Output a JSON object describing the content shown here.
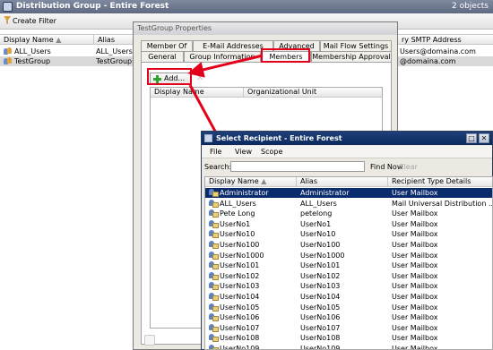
{
  "main": {
    "title": "Distribution Group - Entire Forest",
    "object_count": "2 objects",
    "toolbar": {
      "create_filter": "Create Filter"
    },
    "columns": [
      "Display Name",
      "Alias",
      "ry SMTP Address"
    ],
    "rows": [
      {
        "name": "ALL_Users",
        "alias": "ALL_Users",
        "smtp": "Users@domaina.com"
      },
      {
        "name": "TestGroup",
        "alias": "TestGroup",
        "smtp": "@domaina.com"
      }
    ]
  },
  "props": {
    "title": "TestGroup Properties",
    "tabs_back": [
      "Member Of",
      "E-Mail Addresses",
      "Advanced",
      "Mail Flow Settings"
    ],
    "tabs_front": [
      "General",
      "Group Information",
      "Members",
      "Membership Approval"
    ],
    "add_button": "Add...",
    "columns": [
      "Display Name",
      "Organizational Unit"
    ]
  },
  "select": {
    "title": "Select Recipient - Entire Forest",
    "menu": [
      "File",
      "View",
      "Scope"
    ],
    "search_label": "Search:",
    "search_value": "",
    "find_now": "Find Now",
    "clear": "Clear",
    "columns": [
      "Display Name",
      "Alias",
      "Recipient Type Details"
    ],
    "rows": [
      {
        "name": "Administrator",
        "alias": "Administrator",
        "type": "User Mailbox"
      },
      {
        "name": "ALL_Users",
        "alias": "ALL_Users",
        "type": "Mail Universal Distribution ..."
      },
      {
        "name": "Pete Long",
        "alias": "petelong",
        "type": "User Mailbox"
      },
      {
        "name": "UserNo1",
        "alias": "UserNo1",
        "type": "User Mailbox"
      },
      {
        "name": "UserNo10",
        "alias": "UserNo10",
        "type": "User Mailbox"
      },
      {
        "name": "UserNo100",
        "alias": "UserNo100",
        "type": "User Mailbox"
      },
      {
        "name": "UserNo1000",
        "alias": "UserNo1000",
        "type": "User Mailbox"
      },
      {
        "name": "UserNo101",
        "alias": "UserNo101",
        "type": "User Mailbox"
      },
      {
        "name": "UserNo102",
        "alias": "UserNo102",
        "type": "User Mailbox"
      },
      {
        "name": "UserNo103",
        "alias": "UserNo103",
        "type": "User Mailbox"
      },
      {
        "name": "UserNo104",
        "alias": "UserNo104",
        "type": "User Mailbox"
      },
      {
        "name": "UserNo105",
        "alias": "UserNo105",
        "type": "User Mailbox"
      },
      {
        "name": "UserNo106",
        "alias": "UserNo106",
        "type": "User Mailbox"
      },
      {
        "name": "UserNo107",
        "alias": "UserNo107",
        "type": "User Mailbox"
      },
      {
        "name": "UserNo108",
        "alias": "UserNo108",
        "type": "User Mailbox"
      },
      {
        "name": "UserNo109",
        "alias": "UserNo109",
        "type": "User Mailbox"
      }
    ]
  },
  "colors": {
    "annotation": "#e3001b",
    "selection": "#0a2b6c",
    "title_bar": "#1f3f79"
  }
}
